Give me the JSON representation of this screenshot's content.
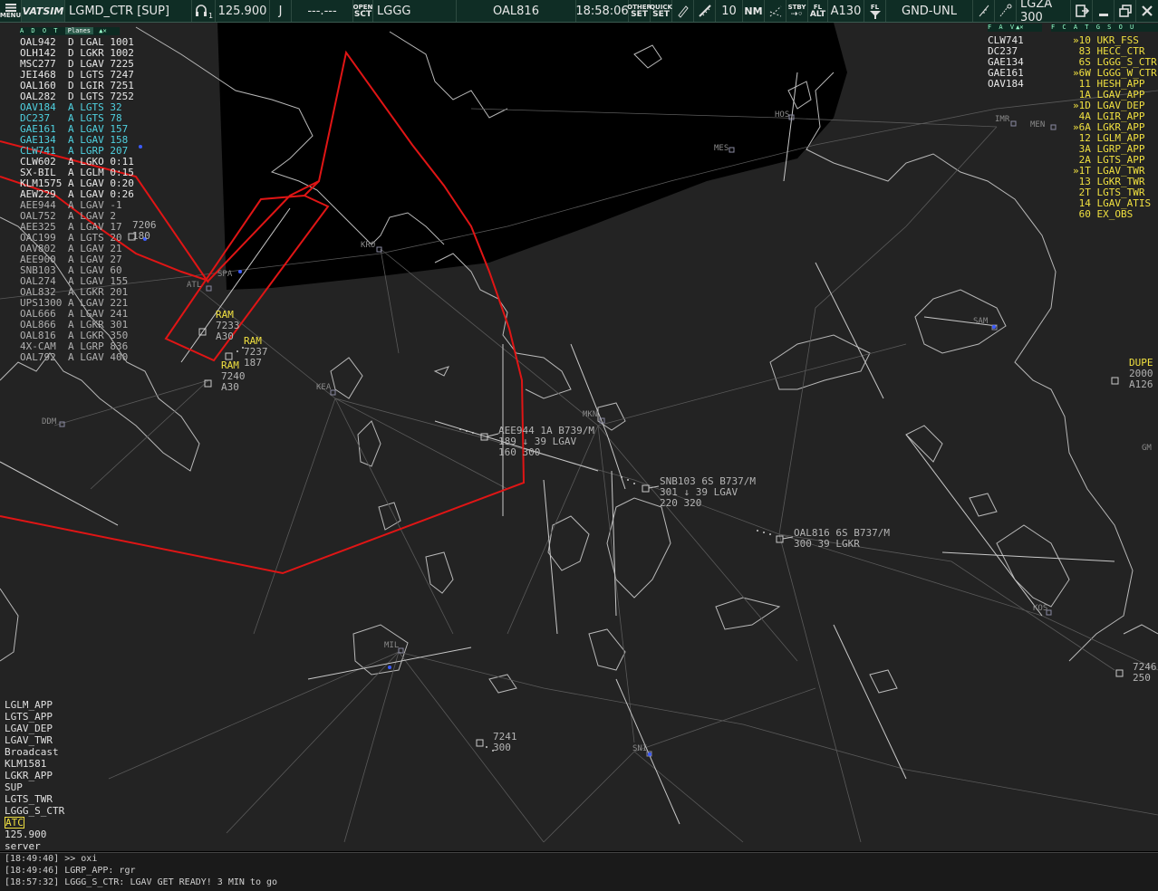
{
  "toolbar": {
    "menu_label": "MENU",
    "logo": "VATSIM",
    "callsign": "LGMD_CTR [SUP]",
    "freq_badge": "1",
    "frequency": "125.900",
    "letter": "J",
    "blank": "---.---",
    "open_top": "OPEN",
    "open_bottom": "SCT",
    "sector": "LGGG",
    "selected_aircraft": "OAL816",
    "time": "18:58:06",
    "other_top": "OTHER",
    "other_bottom": "SET",
    "quick_top": "QUICK",
    "quick_bottom": "SET",
    "range": "10",
    "nm": "NM",
    "stby_top": "STBY",
    "fl_top": "FL",
    "fl_bottom": "ALT",
    "alt": "A130",
    "fl_icon_top": "FL",
    "filter": "GND-UNL",
    "airport": "LGZA 300"
  },
  "left_list": {
    "header": "A D O T",
    "header_tab": "Planes",
    "rows": [
      {
        "text": "OAL942  D LGAL 1001",
        "color": "w"
      },
      {
        "text": "OLH142  D LGKR 1002",
        "color": "w"
      },
      {
        "text": "MSC277  D LGAV 7225",
        "color": "w"
      },
      {
        "text": "JEI468  D LGTS 7247",
        "color": "w"
      },
      {
        "text": "OAL160  D LGIR 7251",
        "color": "w"
      },
      {
        "text": "OAL282  D LGTS 7252",
        "color": "w"
      },
      {
        "text": "OAV184  A LGTS 32",
        "color": "c"
      },
      {
        "text": "DC237   A LGTS 78",
        "color": "c"
      },
      {
        "text": "GAE161  A LGAV 157",
        "color": "c"
      },
      {
        "text": "GAE134  A LGAV 158",
        "color": "c"
      },
      {
        "text": "CLW741  A LGRP 207",
        "color": "c"
      },
      {
        "text": "CLW602  A LGKO 0:11",
        "color": "w"
      },
      {
        "text": "SX-BIL  A LGLM 0:15",
        "color": "w"
      },
      {
        "text": "KLM1575 A LGAV 0:20",
        "color": "w"
      },
      {
        "text": "AEW229  A LGAV 0:26",
        "color": "w"
      },
      {
        "text": "AEE944  A LGAV -1",
        "color": "g"
      },
      {
        "text": "OAL752  A LGAV 2",
        "color": "g"
      },
      {
        "text": "AEE325  A LGAV 17",
        "color": "g"
      },
      {
        "text": "OAC199  A LGTS 20",
        "color": "g"
      },
      {
        "text": "OAV802  A LGAV 21",
        "color": "g"
      },
      {
        "text": "AEE900  A LGAV 27",
        "color": "g"
      },
      {
        "text": "SNB103  A LGAV 60",
        "color": "g"
      },
      {
        "text": "OAL274  A LGAV 155",
        "color": "g"
      },
      {
        "text": "OAL832  A LGKR 201",
        "color": "g"
      },
      {
        "text": "UPS1300 A LGAV 221",
        "color": "g"
      },
      {
        "text": "OAL666  A LGAV 241",
        "color": "g"
      },
      {
        "text": "OAL866  A LGKR 301",
        "color": "g"
      },
      {
        "text": "OAL816  A LGKR 350",
        "color": "g"
      },
      {
        "text": "4X-CAM  A LGRP 836",
        "color": "g"
      },
      {
        "text": "OAL792  A LGAV 400",
        "color": "g"
      }
    ]
  },
  "right_list": {
    "header": "F A V",
    "pilots": [
      "CLW741",
      "DC237",
      "GAE134",
      "GAE161",
      "OAV184"
    ],
    "atc_header": "F C A T G S O U",
    "atc": [
      "»10 UKR_FSS",
      " 83 HECC_CTR",
      " 6S LGGG_S_CTR",
      "»6W LGGG_W_CTR",
      " 11 HESH_APP",
      " 1A LGAV_APP",
      "»1D LGAV_DEP",
      " 4A LGIR_APP",
      "»6A LGKR_APP",
      " 12 LGLM_APP",
      " 3A LGRP_APP",
      " 2A LGTS_APP",
      "»1T LGAV_TWR",
      " 13 LGKR_TWR",
      " 2T LGTS_TWR",
      " 14 LGAV_ATIS",
      " 60 EX_OBS"
    ]
  },
  "tags": {
    "aee944_l1": "AEE944 1A B739/M",
    "aee944_l2": "189 ↓ 39 LGAV",
    "aee944_l3": "160 300",
    "snb103_l1": "SNB103 6S B737/M",
    "snb103_l2": "301 ↓ 39 LGAV",
    "snb103_l3": "220 320",
    "oal816_l1": "OAL816 6S B737/M",
    "oal816_l2": "300 39 LGKR",
    "sq7241_l1": "7241",
    "sq7241_l2": "300",
    "sq7246_l1": "7246",
    "sq7246_l2": "250",
    "sq7206": "7206",
    "sq7206b": "180",
    "dupe_l1": "DUPE",
    "dupe_l2": "2000",
    "dupe_l3": "A126",
    "ram1": "RAM",
    "ram1_a": "7233",
    "ram1_b": "A30",
    "ram2": "RAM",
    "ram2_a": "7237",
    "ram2_b": "187",
    "ram3": "RAM",
    "ram3_a": "7240",
    "ram3_b": "A30"
  },
  "fixes": [
    "HOS",
    "IMR",
    "MEN",
    "MES",
    "KRO",
    "SAM",
    "ATL",
    "KEA",
    "MKN",
    "DDM",
    "MIL",
    "KOS",
    "SNI",
    "SPA",
    "GM"
  ],
  "tabs": [
    "LGLM_APP",
    "LGTS_APP",
    "LGAV_DEP",
    "LGAV_TWR",
    "Broadcast",
    "KLM1581",
    "LGKR_APP",
    "SUP",
    "LGTS_TWR",
    "LGGG_S_CTR",
    "ATC",
    "125.900",
    "server"
  ],
  "chat": [
    "[18:49:40] >> oxi",
    "[18:49:46] LGRP_APP: rgr",
    "[18:57:32] LGGG_S_CTR: LGAV GET READY! 3 MIN to go"
  ]
}
